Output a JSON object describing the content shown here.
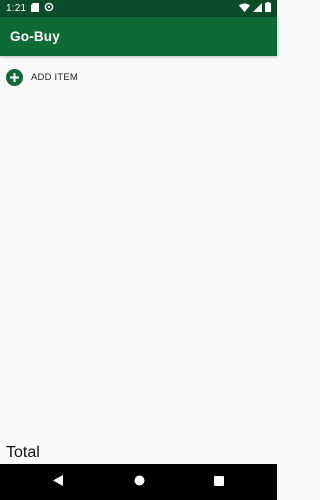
{
  "status_bar": {
    "time": "1:21",
    "icons": [
      "sd-card-icon",
      "sync-icon",
      "wifi-icon",
      "signal-icon",
      "battery-icon"
    ]
  },
  "app_bar": {
    "title": "Go-Buy"
  },
  "main": {
    "add_item_label": "ADD ITEM",
    "total_label": "Total"
  },
  "nav_bar": {
    "buttons": [
      "back-icon",
      "home-icon",
      "recent-apps-icon"
    ]
  },
  "colors": {
    "status_bar": "#0a4d28",
    "app_bar": "#0e6b35",
    "accent": "#0e6b35",
    "background": "#fafafa",
    "nav_bar": "#000000"
  }
}
